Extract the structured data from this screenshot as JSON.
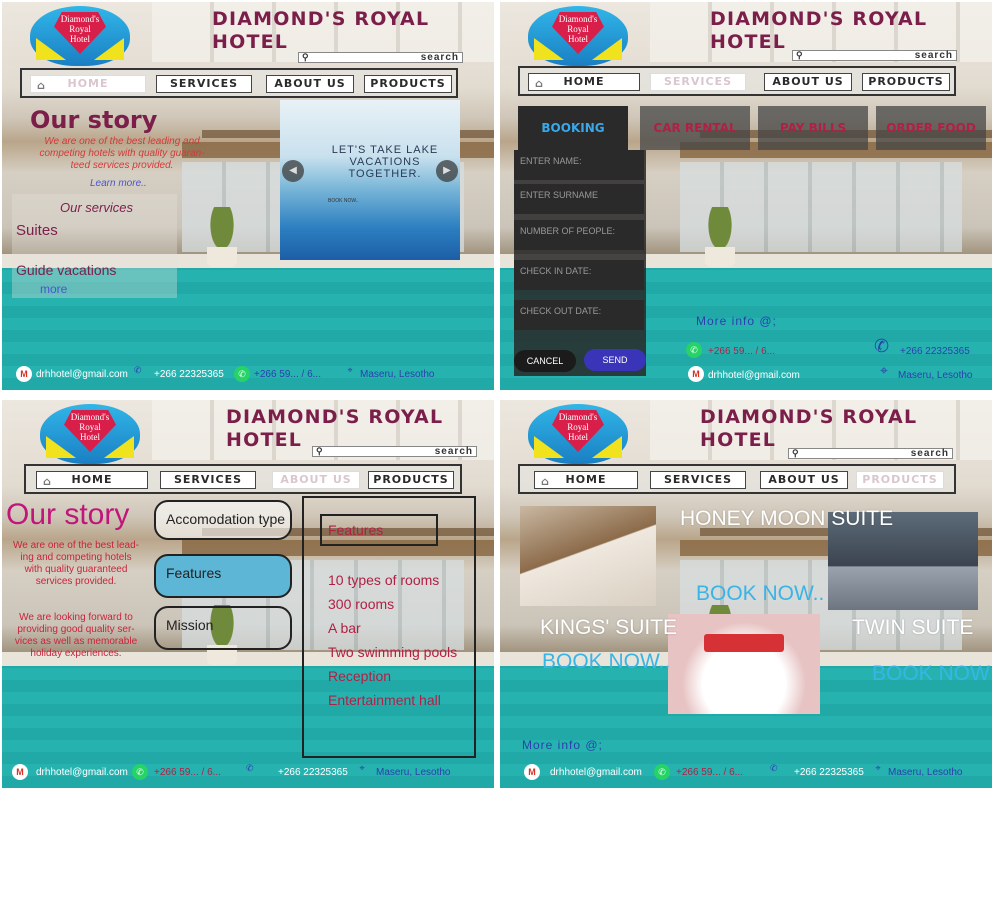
{
  "brand": {
    "logo_text": [
      "Diamond's",
      "Royal",
      "Hotel"
    ],
    "title_line1": "DIAMOND'S ROYAL",
    "title_line2": "HOTEL",
    "search_label": "search"
  },
  "nav": {
    "home": "HOME",
    "services": "SERVICES",
    "about": "ABOUT US",
    "products": "PRODUCTS"
  },
  "footer": {
    "email": "drhhotel@gmail.com",
    "phone": "+266 22325365",
    "whatsapp": "+266 59... / 6...",
    "location": "Maseru, Lesotho",
    "more_info": "More info @;"
  },
  "home_screen": {
    "heading": "Our story",
    "intro_lines": [
      "We are one of the best leading and",
      "competing hotels with quality guaran-",
      "teed services provided."
    ],
    "learn_more": "Learn more..",
    "services_heading": "Our services",
    "service_items": [
      "Suites",
      "Guide vacations"
    ],
    "more_link": "more",
    "slide_caption": "LET'S TAKE LAKE VACATIONS TOGETHER.",
    "slide_booknow": "BOOK NOW..",
    "prev_icon": "◀",
    "next_icon": "▶"
  },
  "services_screen": {
    "tabs": [
      "BOOKING",
      "CAR RENTAL",
      "PAY BILLS",
      "ORDER FOOD"
    ],
    "fields": [
      "ENTER NAME:",
      "ENTER SURNAME",
      "NUMBER OF PEOPLE:",
      "CHECK IN DATE:",
      "CHECK OUT DATE:"
    ],
    "cancel": "CANCEL",
    "send": "SEND"
  },
  "about_screen": {
    "heading": "Our story",
    "para1": [
      "We are one of the best lead-",
      "ing and competing hotels",
      "with quality guaranteed",
      "services provided."
    ],
    "para2": [
      "We are looking forward to",
      "providing good quality ser-",
      "vices as well as memorable",
      "holiday experiences."
    ],
    "menu": [
      "Accomodation type",
      "Features",
      "Mission"
    ],
    "features_title": "Features",
    "features": [
      "10 types of rooms",
      "300 rooms",
      "A bar",
      "Two swimming pools",
      "Reception",
      "Entertainment hall"
    ]
  },
  "products_screen": {
    "rooms": [
      {
        "name": "HONEY MOON SUITE",
        "cta": "BOOK NOW.."
      },
      {
        "name": "KINGS' SUITE",
        "cta": "BOOK NOW.."
      },
      {
        "name": "TWIN SUITE",
        "cta": "BOOK NOW"
      }
    ]
  },
  "colors": {
    "title": "#7b1f4a",
    "accent_blue": "#39b4e7",
    "feature_red": "#b21f44",
    "dark_panel": "#2a2a2a"
  }
}
